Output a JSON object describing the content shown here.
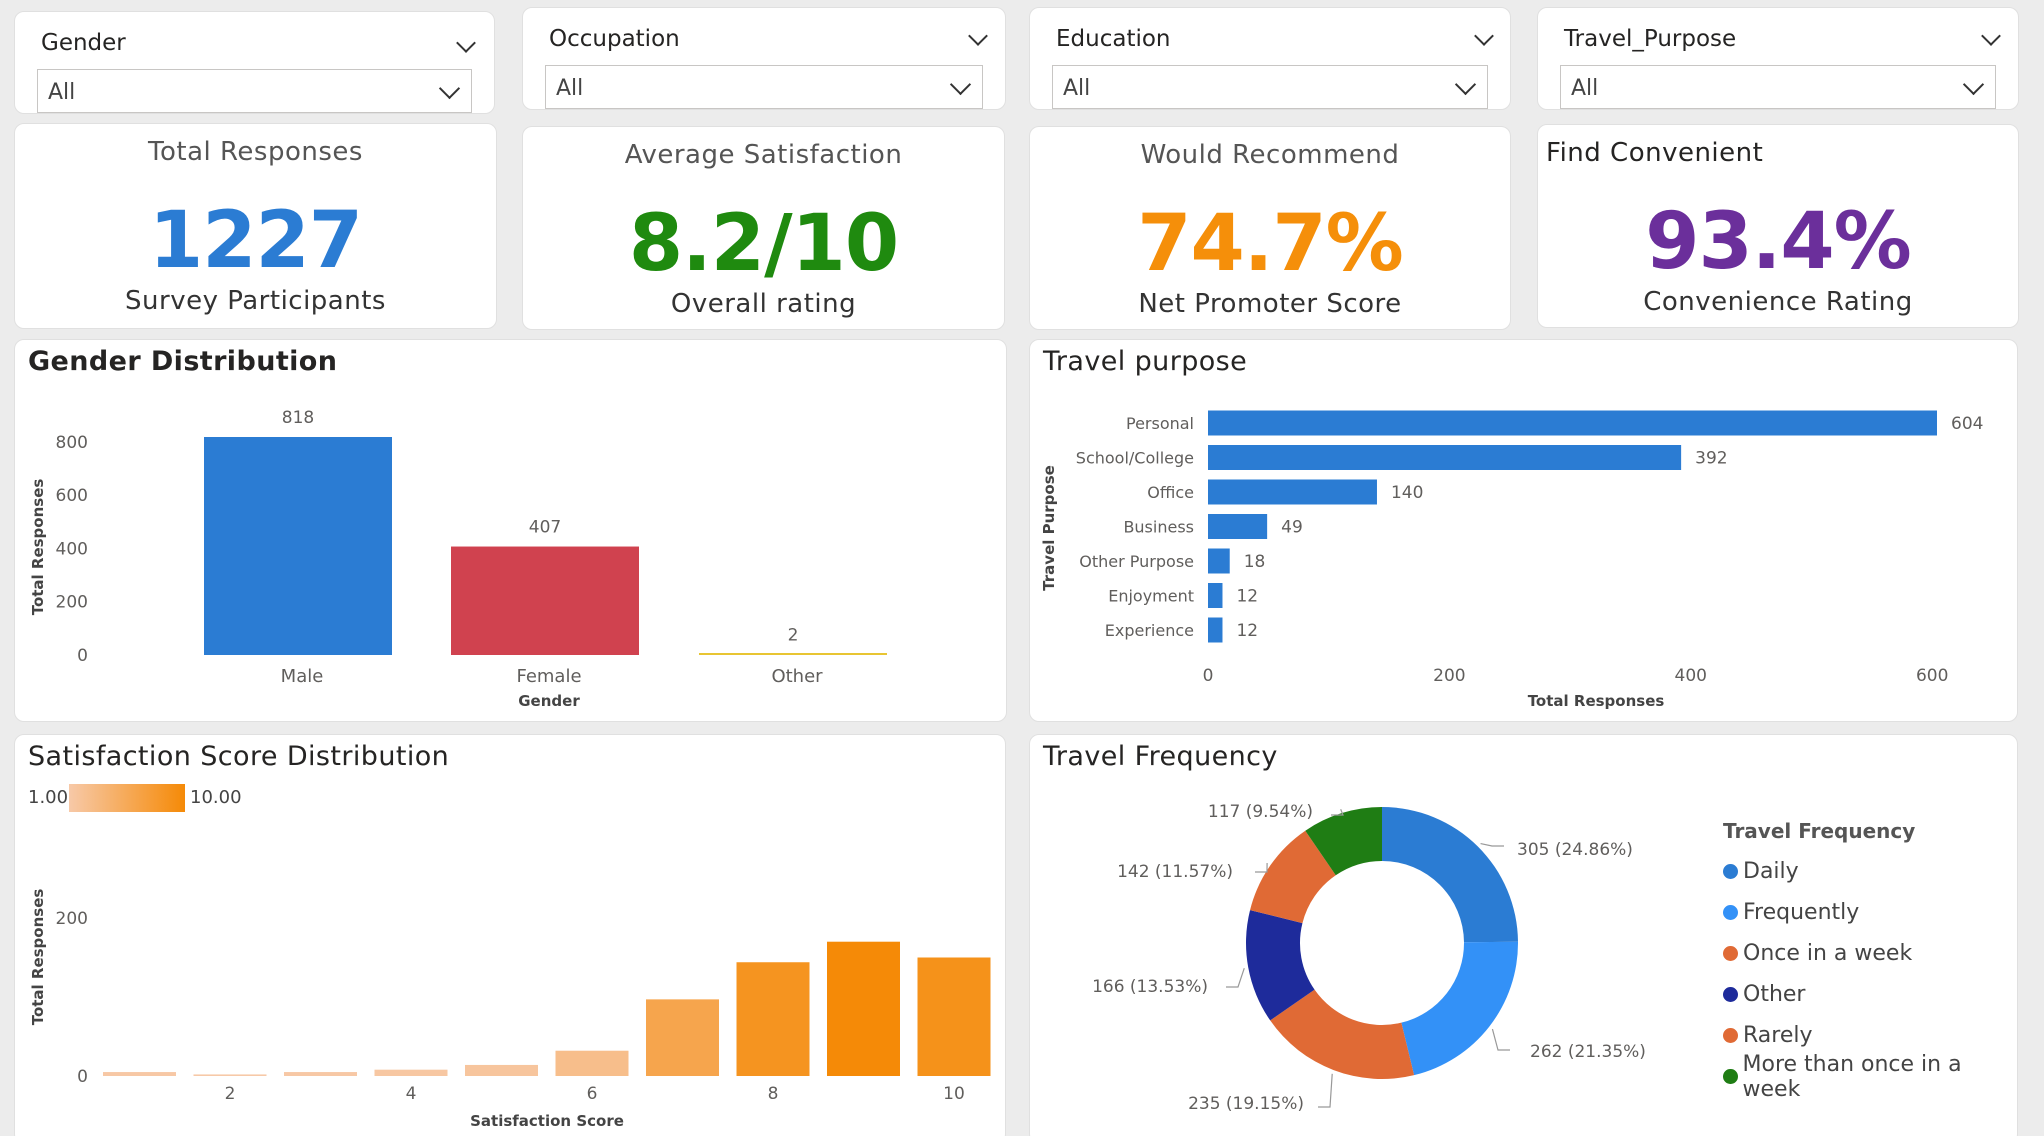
{
  "slicers": [
    {
      "title": "Gender",
      "value": "All"
    },
    {
      "title": "Occupation",
      "value": "All"
    },
    {
      "title": "Education",
      "value": "All"
    },
    {
      "title": "Travel_Purpose",
      "value": "All"
    }
  ],
  "kpis": [
    {
      "title": "Total Responses",
      "value": "1227",
      "subtitle": "Survey Participants",
      "color": "#2b7cd3"
    },
    {
      "title": "Average Satisfaction",
      "value": "8.2/10",
      "subtitle": "Overall rating",
      "color": "#1f8a0f"
    },
    {
      "title": "Would Recommend",
      "value": "74.7%",
      "subtitle": "Net Promoter Score",
      "color": "#f58f0a"
    },
    {
      "title": "Find Convenient",
      "value": "93.4%",
      "subtitle": "Convenience Rating",
      "color": "#6b2f9b"
    }
  ],
  "gender_chart": {
    "title": "Gender Distribution"
  },
  "travel_purpose_chart": {
    "title": "Travel purpose"
  },
  "satisfaction_chart": {
    "title": "Satisfaction Score Distribution",
    "gradient_min": "1.00",
    "gradient_max": "10.00"
  },
  "frequency_chart": {
    "title": "Travel Frequency",
    "legend_title": "Travel Frequency"
  },
  "chart_data": [
    {
      "type": "bar",
      "title": "Gender Distribution",
      "categories": [
        "Male",
        "Female",
        "Other"
      ],
      "values": [
        818,
        407,
        2
      ],
      "colors": [
        "#2b7cd3",
        "#d0424f",
        "#e8c533"
      ],
      "xlabel": "Gender",
      "ylabel": "Total Responses",
      "ylim": [
        0,
        818
      ],
      "yticks": [
        0,
        200,
        400,
        600,
        800
      ]
    },
    {
      "type": "bar",
      "orientation": "horizontal",
      "title": "Travel purpose",
      "categories": [
        "Personal",
        "School/College",
        "Office",
        "Business",
        "Other Purpose",
        "Enjoyment",
        "Experience"
      ],
      "values": [
        604,
        392,
        140,
        49,
        18,
        12,
        12
      ],
      "color": "#2b7cd3",
      "xlabel": "Total Responses",
      "ylabel": "Travel Purpose",
      "xlim": [
        0,
        650
      ],
      "xticks": [
        0,
        200,
        400,
        600
      ]
    },
    {
      "type": "bar",
      "title": "Satisfaction Score Distribution",
      "categories": [
        1,
        2,
        3,
        4,
        5,
        6,
        7,
        8,
        9,
        10
      ],
      "values": [
        5,
        2,
        5,
        8,
        14,
        32,
        97,
        144,
        170,
        150
      ],
      "color_low": "#f7c9a8",
      "color_high": "#f58a07",
      "xlabel": "Satisfaction Score",
      "ylabel": "Total Responses",
      "ylim": [
        0,
        180
      ],
      "yticks": [
        0,
        200
      ],
      "xticks": [
        2,
        4,
        6,
        8,
        10
      ]
    },
    {
      "type": "pie",
      "title": "Travel Frequency",
      "categories": [
        "Daily",
        "Frequently",
        "Once in a week",
        "Other",
        "Rarely",
        "More than once in a week"
      ],
      "values": [
        305,
        262,
        235,
        166,
        142,
        117
      ],
      "labels": [
        "305 (24.86%)",
        "262 (21.35%)",
        "235 (19.15%)",
        "166 (13.53%)",
        "142 (11.57%)",
        "117 (9.54%)"
      ],
      "colors": [
        "#2b7cd3",
        "#3391f7",
        "#e06a35",
        "#1e2b9b",
        "#e06a35",
        "#1f7d14"
      ]
    }
  ]
}
